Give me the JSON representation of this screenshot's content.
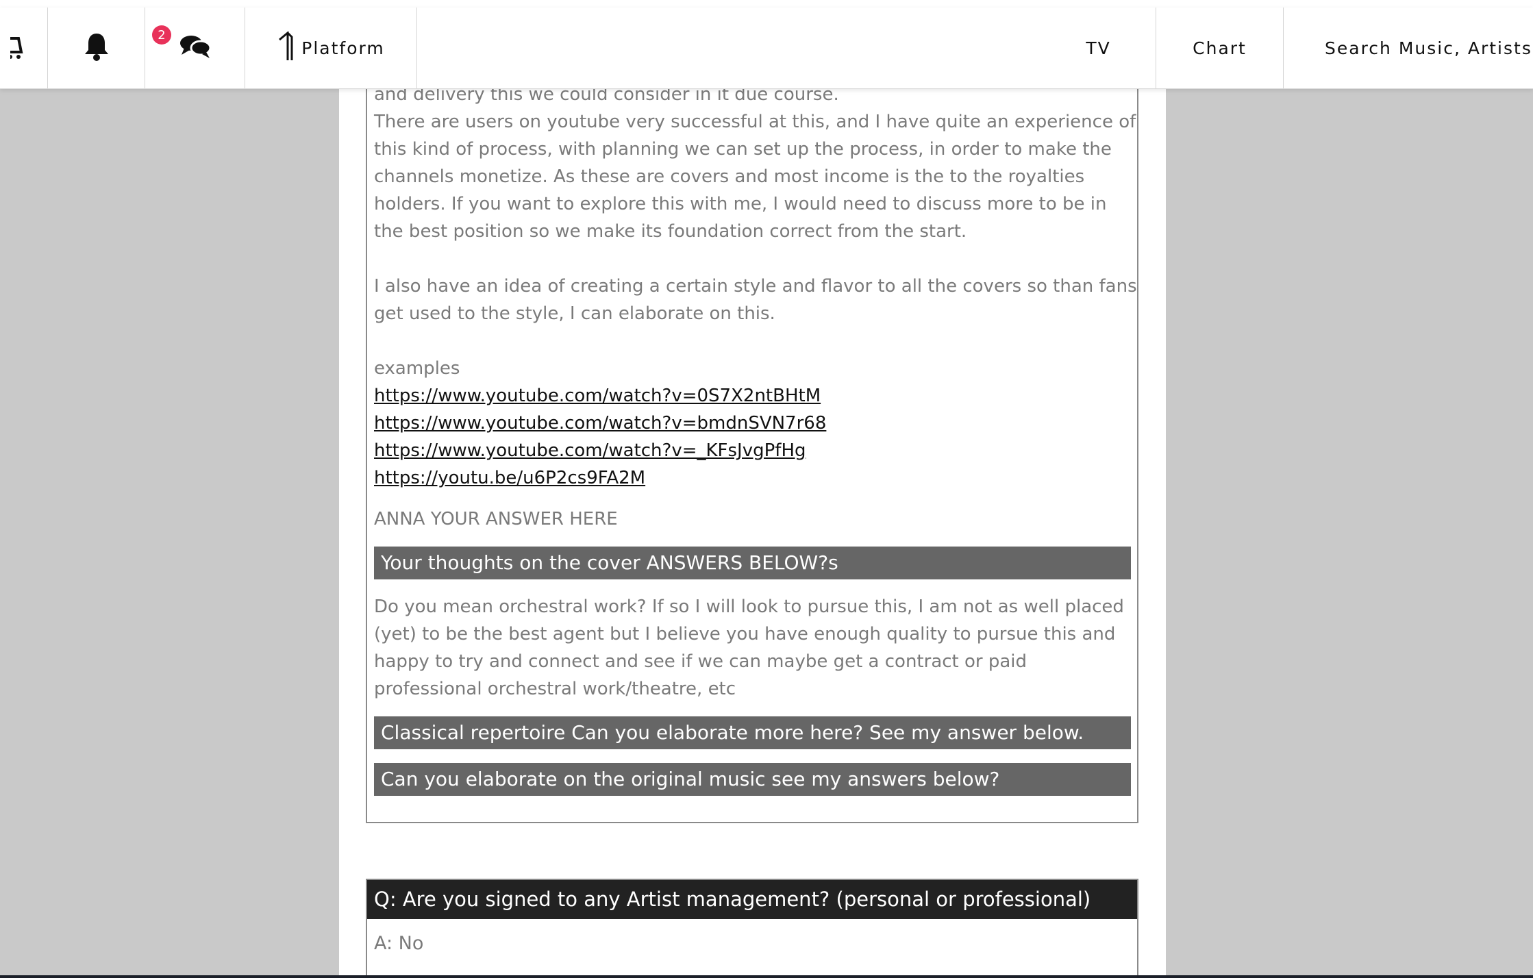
{
  "nav": {
    "notification_count": "2",
    "platform_label": "Platform",
    "tv_label": "TV",
    "chart_label": "Chart",
    "search_placeholder": "Search Music, Artists and",
    "colors": {
      "badge": "#e8325a",
      "text": "#111111"
    },
    "icons": [
      "cart-icon",
      "bell-icon",
      "chat-icon",
      "platform-logo-icon"
    ]
  },
  "content": {
    "paragraph1": [
      "and delivery this we could consider in it due course.",
      "There are users on youtube very successful at this, and I have quite an experience of",
      "this kind of process, with planning we can set up the process, in order to make the",
      "channels monetize. As these are covers and most income is the to the royalties",
      "holders. If you want to explore this with me, I would need to discuss more to be in",
      "the best position so we make its foundation correct from the start."
    ],
    "paragraph2": [
      "I also have an idea of creating a certain style and flavor to all the covers so than fans",
      "get used to the style, I can elaborate on this."
    ],
    "examples_label": "examples",
    "links": [
      "https://www.youtube.com/watch?v=0S7X2ntBHtM",
      "https://www.youtube.com/watch?v=bmdnSVN7r68",
      "https://www.youtube.com/watch?v=_KFsJvgPfHg",
      "https://youtu.be/u6P2cs9FA2M"
    ],
    "anna_answer": "ANNA YOUR ANSWER HERE",
    "bar1": "Your thoughts on the cover ANSWERS BELOW?s",
    "paragraph3": [
      "Do you mean orchestral work? If so I will look to pursue this, I am not as well placed",
      "(yet) to be the best agent but I believe you have enough quality to pursue this and",
      "happy to try and connect and see if we can maybe get a contract or paid",
      "professional orchestral work/theatre, etc"
    ],
    "bar2": "Classical repertoire  Can you elaborate more here? See my answer below.",
    "bar3": "Can you elaborate on the original music see my answers below?"
  },
  "qa": {
    "question": "Q: Are you signed to any Artist management? (personal or professional)",
    "answer": "A: No"
  }
}
